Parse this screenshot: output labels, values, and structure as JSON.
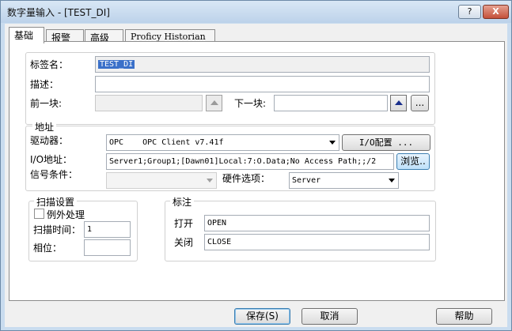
{
  "window": {
    "title": "数字量输入 - [TEST_DI]",
    "help_label": "?",
    "close_label": "X"
  },
  "tabs": [
    {
      "label": "基础"
    },
    {
      "label": "报警"
    },
    {
      "label": "高级"
    },
    {
      "label": "Proficy Historian"
    }
  ],
  "basic": {
    "tag_name_label": "标签名：",
    "tag_name_value": "TEST_DI",
    "description_label": "描述：",
    "description_value": "",
    "prev_block_label": "前一块:",
    "prev_block_value": "",
    "next_block_label": "下一块:",
    "next_block_value": "",
    "ellipsis_label": "..."
  },
  "address": {
    "group_title": "地址",
    "driver_label": "驱动器：",
    "driver_value": "OPC    OPC Client v7.41f",
    "io_config_label": "I/O配置 ...",
    "io_address_label": "I/O地址：",
    "io_address_value": "Server1;Group1;[Dawn01]Local:7:O.Data;No Access Path;;/2",
    "browse_label": "浏览..",
    "signal_condition_label": "信号条件：",
    "signal_condition_value": "",
    "hardware_options_label": "硬件选项：",
    "hardware_options_value": "Server"
  },
  "scan": {
    "group_title": "扫描设置",
    "exception_label": "例外处理",
    "exception_checked": false,
    "scan_time_label": "扫描时间：",
    "scan_time_value": "1",
    "phase_label": "相位：",
    "phase_value": ""
  },
  "labels": {
    "group_title": "标注",
    "open_label": "打开",
    "open_value": "OPEN",
    "close_label": "关闭",
    "close_value": "CLOSE"
  },
  "footer": {
    "save_label": "保存(S)",
    "cancel_label": "取消",
    "help_label": "帮助"
  }
}
